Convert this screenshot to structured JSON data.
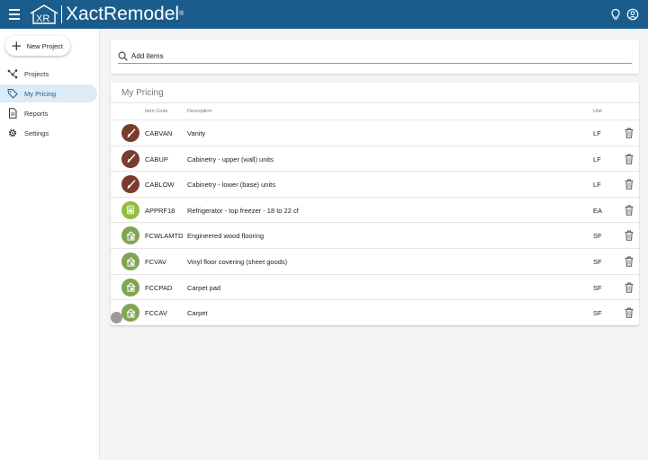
{
  "app": {
    "brand": "XactRemodel",
    "brand_mark": "XR",
    "accent": "#1a5d8c"
  },
  "topbar": {
    "menu_icon": "hamburger-icon",
    "actions": [
      "lightbulb-icon",
      "account-icon"
    ]
  },
  "sidebar": {
    "new_project_label": "New Project",
    "items": [
      {
        "label": "Projects",
        "icon": "projects-icon",
        "active": false
      },
      {
        "label": "My Pricing",
        "icon": "tag-icon",
        "active": true
      },
      {
        "label": "Reports",
        "icon": "document-icon",
        "active": false
      },
      {
        "label": "Settings",
        "icon": "gear-icon",
        "active": false
      }
    ]
  },
  "search": {
    "placeholder": "Add items"
  },
  "pricing": {
    "title": "My Pricing",
    "columns": {
      "code": "Item Code",
      "description": "Description",
      "unit": "Unit"
    },
    "rows": [
      {
        "code": "CABVAN",
        "description": "Vanity",
        "unit": "LF",
        "icon": "brush-icon",
        "color": "#7a3b2e"
      },
      {
        "code": "CABUP",
        "description": "Cabinetry - upper (wall) units",
        "unit": "LF",
        "icon": "brush-icon",
        "color": "#7a3b2e"
      },
      {
        "code": "CABLOW",
        "description": "Cabinetry - lower (base) units",
        "unit": "LF",
        "icon": "brush-icon",
        "color": "#7a3b2e"
      },
      {
        "code": "APPRF18",
        "description": "Refrigerator - top freezer - 18 to 22 cf",
        "unit": "EA",
        "icon": "appliance-icon",
        "color": "#93bb3c"
      },
      {
        "code": "FCWLAMTD",
        "description": "Engineered wood flooring",
        "unit": "SF",
        "icon": "flooring-icon",
        "color": "#7fa552"
      },
      {
        "code": "FCVAV",
        "description": "Vinyl floor covering (sheet goods)",
        "unit": "SF",
        "icon": "flooring-icon",
        "color": "#7fa552"
      },
      {
        "code": "FCCPAD",
        "description": "Carpet pad",
        "unit": "SF",
        "icon": "flooring-icon",
        "color": "#7fa552"
      },
      {
        "code": "FCCAV",
        "description": "Carpet",
        "unit": "SF",
        "icon": "flooring-icon",
        "color": "#7fa552"
      }
    ]
  }
}
